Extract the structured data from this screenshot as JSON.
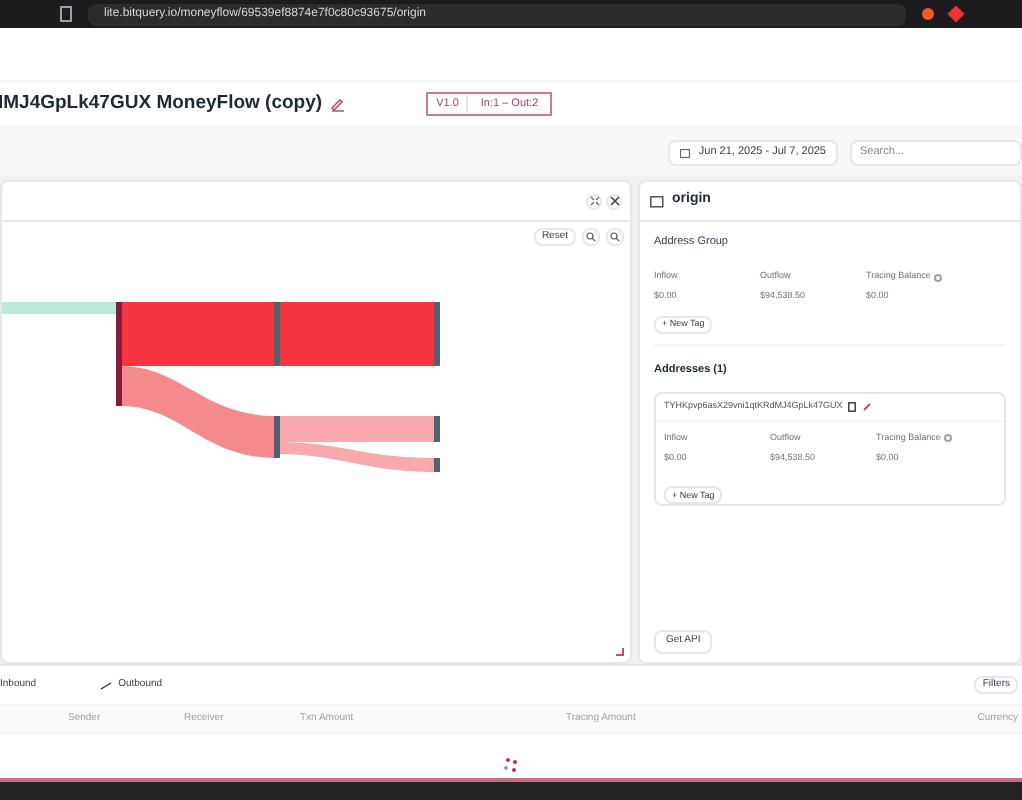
{
  "browser": {
    "url": "lite.bitquery.io/moneyflow/69539ef8874e7f0c80c93675/origin"
  },
  "header": {
    "title": "IMJ4GpLk47GUX MoneyFlow (copy)",
    "version": "V1.0",
    "io": "In:1 – Out:2"
  },
  "toolbar": {
    "date_range": "Jun 21, 2025 - Jul 7, 2025",
    "search_placeholder": "Search..."
  },
  "graph": {
    "reset": "Reset"
  },
  "details": {
    "title": "origin",
    "group_label": "Address Group",
    "group_stats": [
      {
        "label": "Inflow",
        "value": "$0.00",
        "info": false
      },
      {
        "label": "Outflow",
        "value": "$94,538.50",
        "info": false
      },
      {
        "label": "Tracing Balance",
        "value": "$0.00",
        "info": true
      }
    ],
    "new_tag": "+ New Tag",
    "addresses_title": "Addresses (1)",
    "address": "TYHKpvp6asX29vni1qtKRdMJ4GpLk47GUX",
    "address_stats": [
      {
        "label": "Inflow",
        "value": "$0.00",
        "info": false
      },
      {
        "label": "Outflow",
        "value": "$94,538.50",
        "info": false
      },
      {
        "label": "Tracing Balance",
        "value": "$0.00",
        "info": true
      }
    ],
    "address_new_tag": "+ New Tag",
    "get_api": "Get API"
  },
  "transfers": {
    "tabs": [
      {
        "label": "Inbound",
        "selected": false
      },
      {
        "label": "Outbound",
        "selected": false
      }
    ],
    "filters": "Filters",
    "columns": [
      "Sender",
      "Receiver",
      "Txn Amount",
      "Tracing Amount",
      "Currency"
    ]
  }
}
